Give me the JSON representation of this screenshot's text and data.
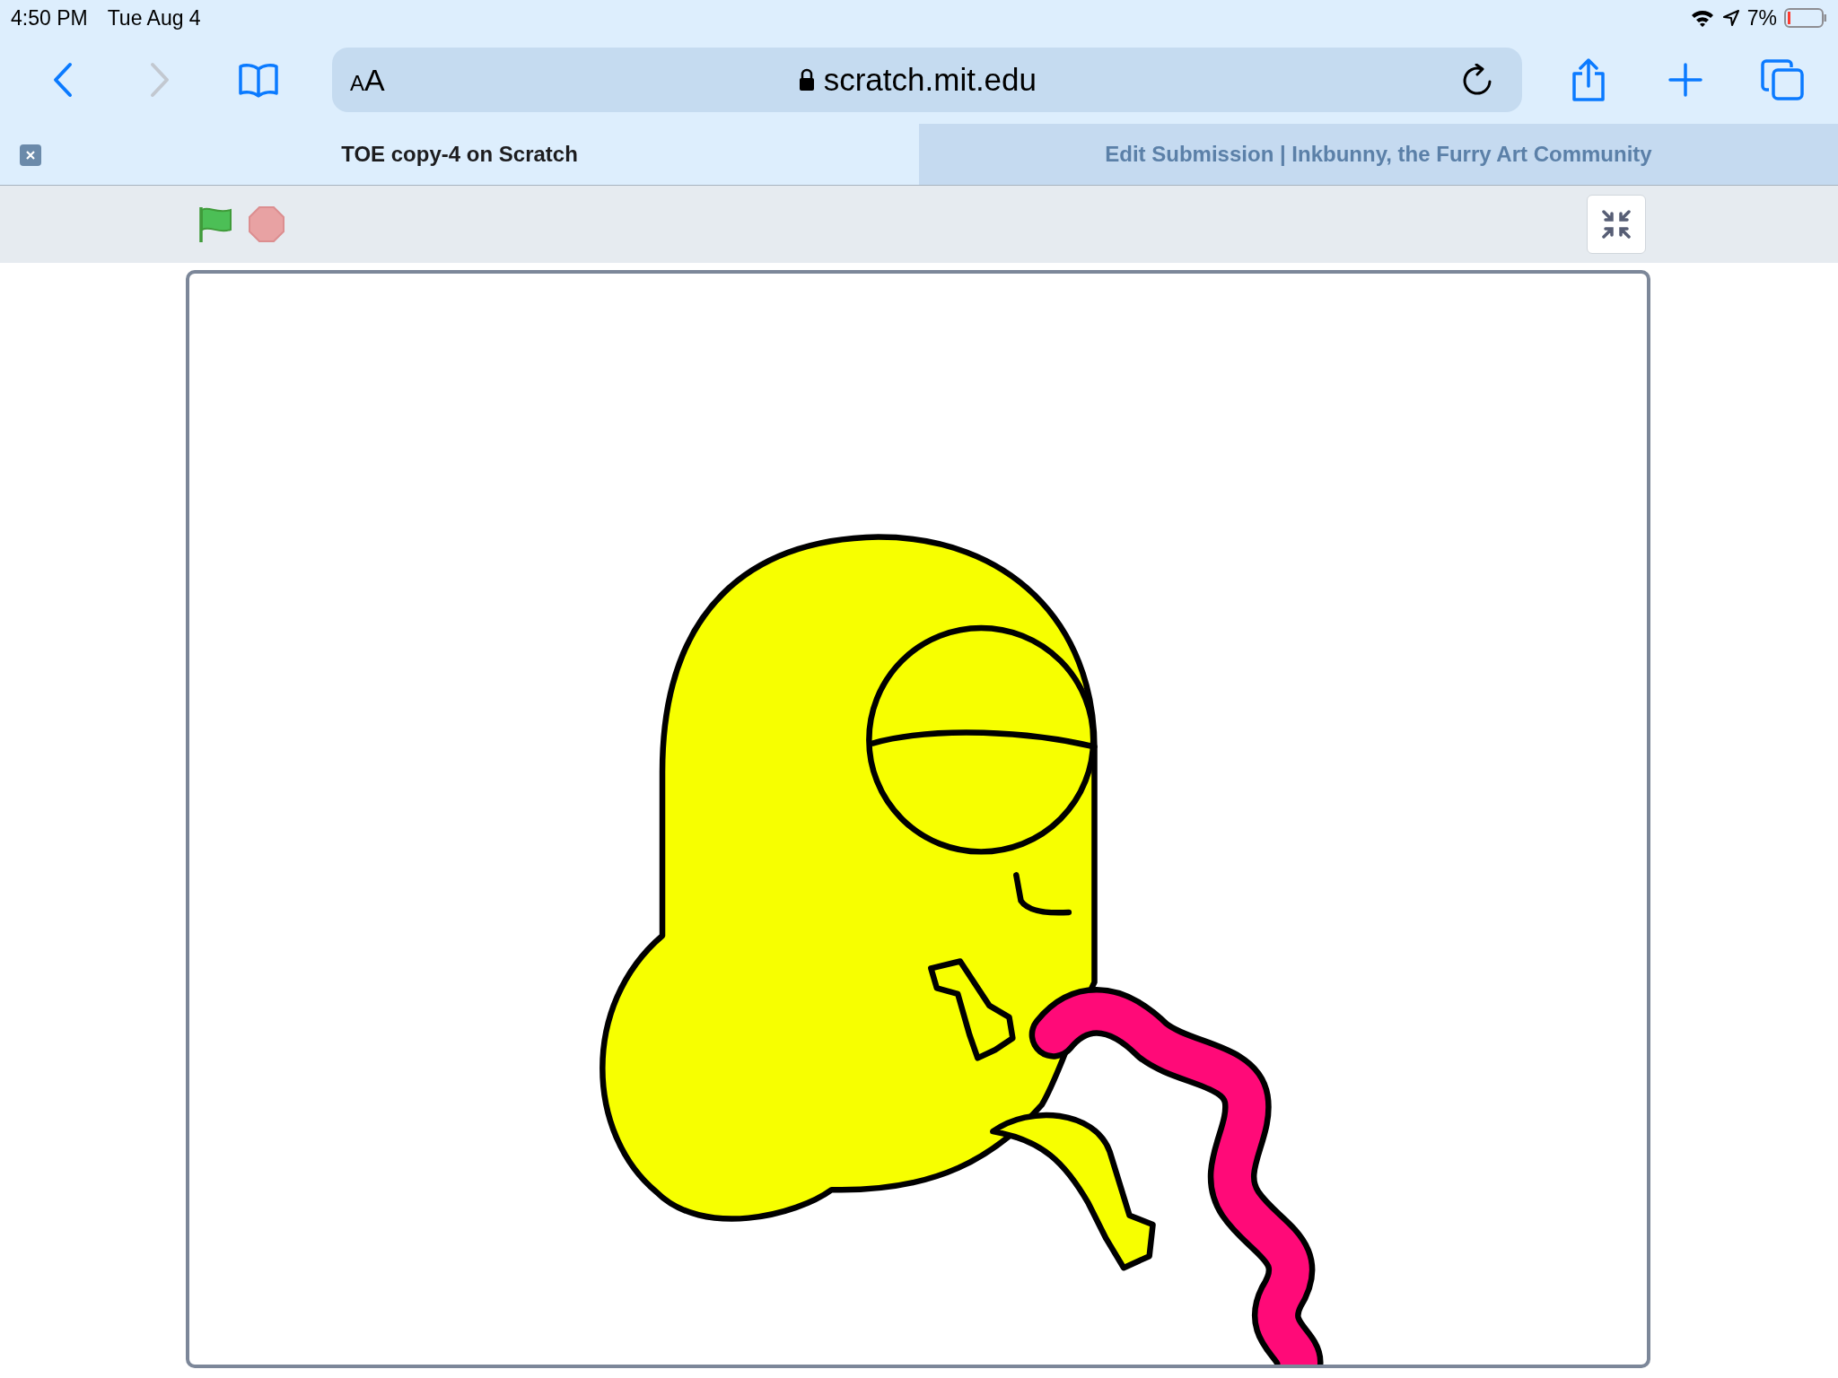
{
  "status_bar": {
    "time": "4:50 PM",
    "date": "Tue Aug 4",
    "battery": "7%"
  },
  "toolbar": {
    "text_size": "AA",
    "url": "scratch.mit.edu"
  },
  "tabs": [
    {
      "label": "TOE copy-4 on Scratch",
      "selected": true
    },
    {
      "label": "Edit Submission | Inkbunny, the Furry Art Community",
      "selected": false
    }
  ]
}
